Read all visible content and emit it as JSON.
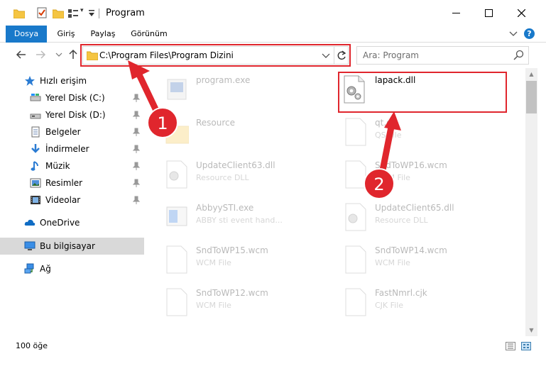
{
  "window": {
    "title": "Program",
    "minimize_icon": "minimize-icon",
    "maximize_icon": "maximize-icon",
    "close_icon": "close-icon"
  },
  "ribbon": {
    "tabs": [
      {
        "label": "Dosya"
      },
      {
        "label": "Giriş"
      },
      {
        "label": "Paylaş"
      },
      {
        "label": "Görünüm"
      }
    ],
    "help_label": "?"
  },
  "address": {
    "path": "C:\\Program Files\\Program Dizini"
  },
  "search": {
    "placeholder": "Ara: Program"
  },
  "sidebar": {
    "items": [
      {
        "label": "Hızlı erişim",
        "icon": "star-icon"
      },
      {
        "label": "Yerel Disk (C:)",
        "icon": "drive-icon"
      },
      {
        "label": "Yerel Disk (D:)",
        "icon": "drive-icon"
      },
      {
        "label": "Belgeler",
        "icon": "documents-icon"
      },
      {
        "label": "İndirmeler",
        "icon": "download-icon"
      },
      {
        "label": "Müzik",
        "icon": "music-icon"
      },
      {
        "label": "Resimler",
        "icon": "pictures-icon"
      },
      {
        "label": "Videolar",
        "icon": "video-icon"
      },
      {
        "label": "OneDrive",
        "icon": "cloud-icon"
      },
      {
        "label": "Bu bilgisayar",
        "icon": "computer-icon"
      },
      {
        "label": "Ağ",
        "icon": "network-icon"
      }
    ]
  },
  "files": [
    {
      "name": "program.exe",
      "type": ""
    },
    {
      "name": "lapack.dll",
      "type": ""
    },
    {
      "name": "Resource",
      "type": ""
    },
    {
      "name": "qt.qs",
      "type": "QS File"
    },
    {
      "name": "UpdateClient63.dll",
      "type": "Resource DLL"
    },
    {
      "name": "SndToWP16.wcm",
      "type": "WCM File"
    },
    {
      "name": "AbbyySTI.exe",
      "type": "ABBY sti event hand..."
    },
    {
      "name": "UpdateClient65.dll",
      "type": "Resource DLL"
    },
    {
      "name": "SndToWP15.wcm",
      "type": "WCM File"
    },
    {
      "name": "SndToWP14.wcm",
      "type": "WCM File"
    },
    {
      "name": "SndToWP12.wcm",
      "type": "WCM File"
    },
    {
      "name": "FastNmrl.cjk",
      "type": "CJK File"
    }
  ],
  "status": {
    "item_count": "100 öğe"
  },
  "annotations": {
    "step1": "1",
    "step2": "2",
    "color": "#e0262d"
  }
}
